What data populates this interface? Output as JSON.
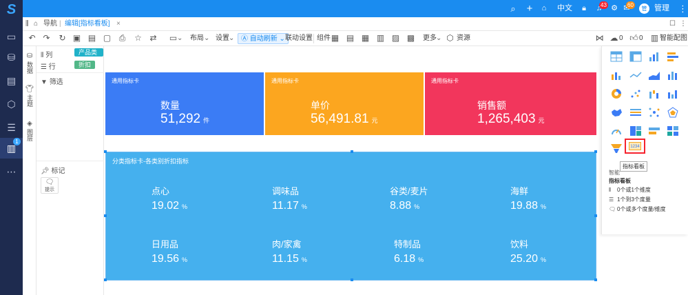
{
  "app": {
    "logo": "S"
  },
  "leftbar": {
    "badge": "1"
  },
  "topbar": {
    "lang": "中文",
    "badge_bell": "43",
    "badge_msg": "60",
    "avatar": "管",
    "username": "管理员"
  },
  "tabs": {
    "nav": "导航",
    "active": "编辑[指标看板]"
  },
  "toolbar": {
    "layout": "布局",
    "settings": "设置",
    "auto_refresh": "自动刷新",
    "linkage": "联动设置",
    "component": "组件",
    "more": "更多",
    "resource": "资源",
    "comment_count": "0",
    "like_count": "0",
    "smart": "智能配图"
  },
  "sidepanel": {
    "data": "数据",
    "theme": "主题",
    "layer": "图层"
  },
  "fieldpanel": {
    "columns_label": "列",
    "columns_tag": "产品类别",
    "rows_label": "行",
    "rows_tag": "折扣",
    "filter_label": "筛选",
    "mark_label": "标记",
    "hint_label": "提示"
  },
  "cards": [
    {
      "title": "通用指标卡",
      "label": "数量",
      "value": "51,292",
      "unit": "件",
      "color": "#3b7cf5"
    },
    {
      "title": "通用指标卡",
      "label": "单价",
      "value": "56,491.81",
      "unit": "元",
      "color": "#fca61f"
    },
    {
      "title": "通用指标卡",
      "label": "销售额",
      "value": "1,265,403",
      "unit": "元",
      "color": "#f2365c"
    }
  ],
  "bigcard": {
    "title": "分类指标卡-各类别折扣指标",
    "items": [
      {
        "name": "点心",
        "value": "19.02",
        "unit": "%"
      },
      {
        "name": "调味品",
        "value": "11.17",
        "unit": "%"
      },
      {
        "name": "谷类/麦片",
        "value": "8.88",
        "unit": "%"
      },
      {
        "name": "海鲜",
        "value": "19.88",
        "unit": "%"
      },
      {
        "name": "日用品",
        "value": "19.56",
        "unit": "%"
      },
      {
        "name": "肉/家禽",
        "value": "11.15",
        "unit": "%"
      },
      {
        "name": "特制品",
        "value": "6.18",
        "unit": "%"
      },
      {
        "name": "饮料",
        "value": "25.20",
        "unit": "%"
      }
    ]
  },
  "rightpanel": {
    "selected_icon_text": "1234",
    "tooltip": "指标看板",
    "section_title_partial": "智能",
    "chart_name": "指标看板",
    "req1": "0个或1个维度",
    "req2": "1个到3个度量",
    "req3": "0个或多个度量/维度"
  }
}
